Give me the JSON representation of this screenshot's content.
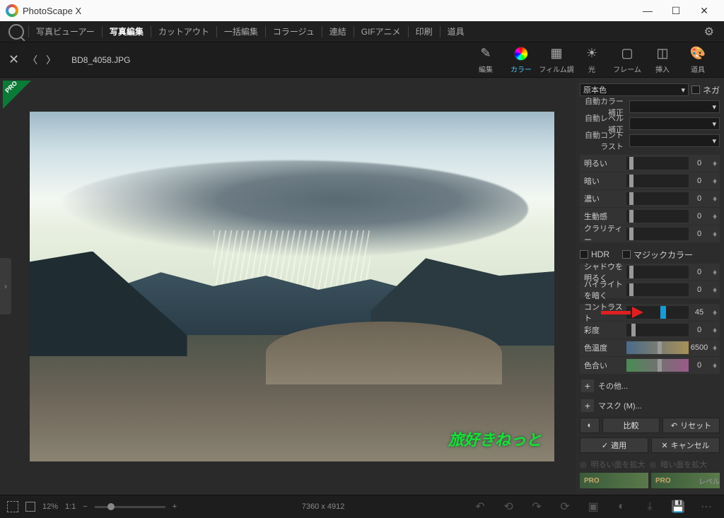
{
  "window": {
    "title": "PhotoScape X"
  },
  "menu": {
    "items": [
      "写真ビューアー",
      "写真編集",
      "カットアウト",
      "一括編集",
      "コラージュ",
      "連結",
      "GIFアニメ",
      "印刷",
      "道具"
    ],
    "activeIndex": 1
  },
  "toolbar": {
    "filename": "BD8_4058.JPG",
    "buttons": [
      {
        "id": "edit",
        "label": "編集"
      },
      {
        "id": "color",
        "label": "カラー"
      },
      {
        "id": "film",
        "label": "フィルム調"
      },
      {
        "id": "light",
        "label": "光"
      },
      {
        "id": "frame",
        "label": "フレーム"
      },
      {
        "id": "insert",
        "label": "挿入"
      },
      {
        "id": "tools",
        "label": "道具"
      }
    ],
    "activeId": "color"
  },
  "panel": {
    "preset": "原本色",
    "nega": "ネガ",
    "autoColor": "自動カラー補正",
    "autoLevel": "自動レベル補正",
    "autoContrast": "自動コントラスト",
    "sliders1": [
      {
        "label": "明るい",
        "value": 0
      },
      {
        "label": "暗い",
        "value": 0
      },
      {
        "label": "濃い",
        "value": 0
      },
      {
        "label": "生動感",
        "value": 0
      },
      {
        "label": "クラリティー",
        "value": 0
      }
    ],
    "hdr": "HDR",
    "magic": "マジックカラー",
    "sliders2": [
      {
        "label": "シャドウを明るく",
        "value": 0
      },
      {
        "label": "ハイライトを暗く",
        "value": 0
      }
    ],
    "sliders3": [
      {
        "label": "コントラスト",
        "value": 45,
        "thumb": 55
      },
      {
        "label": "彩度",
        "value": 0,
        "thumb": 8
      },
      {
        "label": "色温度",
        "value": 6500,
        "thumb": 50,
        "grad": "warm"
      },
      {
        "label": "色合い",
        "value": 0,
        "thumb": 50,
        "grad": "tint"
      }
    ],
    "other": "その他...",
    "mask": "マスク (M)...",
    "compare": "比較",
    "reset": "リセット",
    "apply": "適用",
    "cancel": "キャンセル",
    "disabled": {
      "a": "明るい面を拡大",
      "b": "暗い面を拡大",
      "level": "レベル"
    },
    "pro": "PRO"
  },
  "watermark": "旅好きねっと",
  "bottom": {
    "zoom": "12%",
    "fit": "1:1",
    "dims": "7360 x 4912"
  }
}
